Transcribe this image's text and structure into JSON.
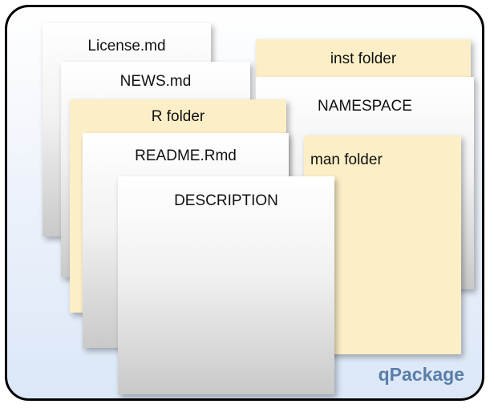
{
  "cards": [
    {
      "id": "license",
      "label": "License.md",
      "color": "gray"
    },
    {
      "id": "inst",
      "label": "inst folder",
      "color": "yellow"
    },
    {
      "id": "news",
      "label": "NEWS.md",
      "color": "gray"
    },
    {
      "id": "namespace",
      "label": "NAMESPACE",
      "color": "gray"
    },
    {
      "id": "r",
      "label": "R folder",
      "color": "yellow"
    },
    {
      "id": "readme",
      "label": "README.Rmd",
      "color": "gray"
    },
    {
      "id": "man",
      "label": "man folder",
      "color": "yellow"
    },
    {
      "id": "description",
      "label": "DESCRIPTION",
      "color": "gray"
    }
  ],
  "brand": "qPackage",
  "colors": {
    "border": "#000000",
    "yellow_card": "#fcefc7",
    "gray_card_top": "#ffffff",
    "gray_card_bottom": "#c9c9c9",
    "brand_text": "#5a7ea8",
    "background_bottom": "#dbe7f7"
  }
}
